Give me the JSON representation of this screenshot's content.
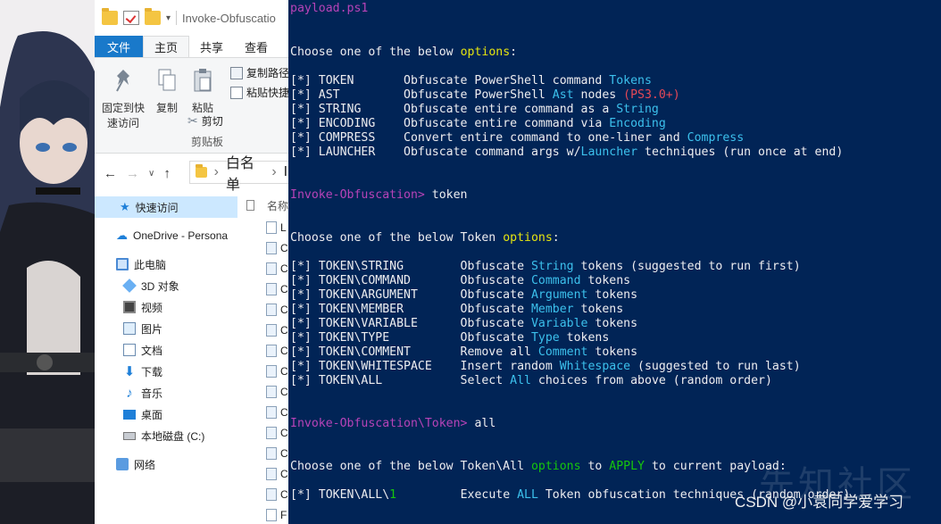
{
  "explorer": {
    "title": "Invoke-Obfuscatio",
    "tabs": [
      "文件",
      "主页",
      "共享",
      "查看"
    ],
    "ribbon": {
      "pin_label_1": "固定到快",
      "pin_label_2": "速访问",
      "copy_label": "复制",
      "paste_label": "粘贴",
      "copy_path_label": "复制路径",
      "paste_shortcut_label": "粘贴快捷",
      "cut_label": "剪切",
      "group_label": "剪贴板"
    },
    "address": {
      "crumb1": "白名单",
      "crumb_sep": "›",
      "crumb2": "In"
    },
    "column_header": "名称",
    "nav_items": [
      {
        "label": "快速访问",
        "icon": "star-icon"
      },
      {
        "label": "OneDrive - Persona",
        "icon": "cloud-icon"
      },
      {
        "label": "此电脑",
        "icon": "computer-icon"
      },
      {
        "label": "3D 对象",
        "icon": "cube-icon"
      },
      {
        "label": "视频",
        "icon": "video-icon"
      },
      {
        "label": "图片",
        "icon": "picture-icon"
      },
      {
        "label": "文档",
        "icon": "document-icon"
      },
      {
        "label": "下载",
        "icon": "download-icon"
      },
      {
        "label": "音乐",
        "icon": "music-icon"
      },
      {
        "label": "桌面",
        "icon": "desktop-icon"
      },
      {
        "label": "本地磁盘 (C:)",
        "icon": "drive-icon"
      },
      {
        "label": "网络",
        "icon": "network-icon"
      }
    ],
    "files": [
      "L",
      "C",
      "C",
      "C",
      "C",
      "C",
      "C",
      "C",
      "C",
      "C",
      "C",
      "C",
      "C",
      "C",
      "F",
      "F"
    ]
  },
  "terminal": {
    "l0": "payload.ps1",
    "l1_a": "Choose one of the below ",
    "l1_b": "options",
    "l1_c": ":",
    "opt_token": "[*] TOKEN       Obfuscate PowerShell command ",
    "opt_token_hl": "Tokens",
    "opt_ast": "[*] AST         Obfuscate PowerShell ",
    "opt_ast_hl": "Ast",
    "opt_ast_b": " nodes ",
    "opt_ast_r": "(PS3.0+)",
    "opt_string": "[*] STRING      Obfuscate entire command as a ",
    "opt_string_hl": "String",
    "opt_encoding": "[*] ENCODING    Obfuscate entire command via ",
    "opt_encoding_hl": "Encoding",
    "opt_compress": "[*] COMPRESS    Convert entire command to one-liner and ",
    "opt_compress_hl": "Compress",
    "opt_launcher": "[*] LAUNCHER    Obfuscate command args w/",
    "opt_launcher_hl": "Launcher",
    "opt_launcher_b": " techniques (run once at end)",
    "prompt1": "Invoke-Obfuscation> ",
    "cmd1": "token",
    "l2_a": "Choose one of the below Token ",
    "l2_b": "options",
    "l2_c": ":",
    "t_string": "[*] TOKEN\\STRING        Obfuscate ",
    "t_string_hl": "String",
    "t_string_b": " tokens (suggested to run first)",
    "t_command": "[*] TOKEN\\COMMAND       Obfuscate ",
    "t_command_hl": "Command",
    "t_command_b": " tokens",
    "t_argument": "[*] TOKEN\\ARGUMENT      Obfuscate ",
    "t_argument_hl": "Argument",
    "t_argument_b": " tokens",
    "t_member": "[*] TOKEN\\MEMBER        Obfuscate ",
    "t_member_hl": "Member",
    "t_member_b": " tokens",
    "t_variable": "[*] TOKEN\\VARIABLE      Obfuscate ",
    "t_variable_hl": "Variable",
    "t_variable_b": " tokens",
    "t_type": "[*] TOKEN\\TYPE          Obfuscate ",
    "t_type_hl": "Type",
    "t_type_b": " tokens",
    "t_comment": "[*] TOKEN\\COMMENT       Remove all ",
    "t_comment_hl": "Comment",
    "t_comment_b": " tokens",
    "t_whitespace": "[*] TOKEN\\WHITESPACE    Insert random ",
    "t_whitespace_hl": "Whitespace",
    "t_whitespace_b": " (suggested to run last)",
    "t_all": "[*] TOKEN\\ALL           Select ",
    "t_all_hl": "All",
    "t_all_b": " choices from above (random order)",
    "prompt2": "Invoke-Obfuscation\\Token> ",
    "cmd2": "all",
    "l3_a": "Choose one of the below Token\\All ",
    "l3_b": "options",
    "l3_c": " to ",
    "l3_d": "APPLY",
    "l3_e": " to current payload:",
    "a1_a": "[*] TOKEN\\ALL\\",
    "a1_b": "1",
    "a1_c": "         Execute ",
    "a1_d": "ALL",
    "a1_e": " Token obfuscation techniques (random order)"
  },
  "watermark": {
    "text": "CSDN @小袁同学爱学习",
    "ghost": "先知社区"
  },
  "colors": {
    "terminal_bg": "#012456",
    "highlight": "#3cc0ec",
    "prompt": "#b843b8",
    "warning": "#e74856",
    "options": "#e5e510",
    "apply": "#13a10e",
    "ribbon_file": "#1979ca"
  }
}
